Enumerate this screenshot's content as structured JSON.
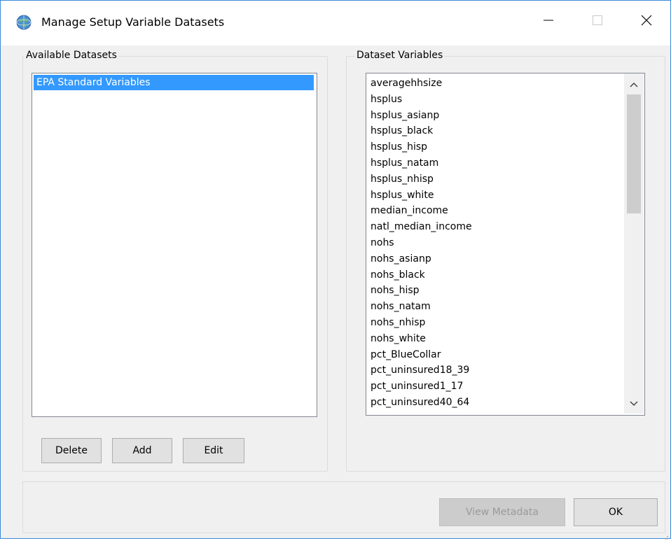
{
  "window": {
    "title": "Manage Setup Variable Datasets",
    "icons": {
      "app": "globe-icon",
      "minimize": "minimize-icon",
      "maximize": "maximize-icon",
      "close": "close-icon"
    }
  },
  "available_datasets": {
    "label": "Available Datasets",
    "items": [
      "EPA Standard Variables"
    ],
    "selected_index": 0,
    "buttons": {
      "delete": "Delete",
      "add": "Add",
      "edit": "Edit"
    }
  },
  "dataset_variables": {
    "label": "Dataset Variables",
    "items": [
      "averagehhsize",
      "hsplus",
      "hsplus_asianp",
      "hsplus_black",
      "hsplus_hisp",
      "hsplus_natam",
      "hsplus_nhisp",
      "hsplus_white",
      "median_income",
      "natl_median_income",
      "nohs",
      "nohs_asianp",
      "nohs_black",
      "nohs_hisp",
      "nohs_natam",
      "nohs_nhisp",
      "nohs_white",
      "pct_BlueCollar",
      "pct_uninsured18_39",
      "pct_uninsured1_17",
      "pct_uninsured40_64"
    ]
  },
  "footer": {
    "view_metadata": "View Metadata",
    "ok": "OK"
  },
  "colors": {
    "selection": "#3399ff",
    "window_border": "#3b8ad9",
    "background": "#f0f0f0"
  }
}
